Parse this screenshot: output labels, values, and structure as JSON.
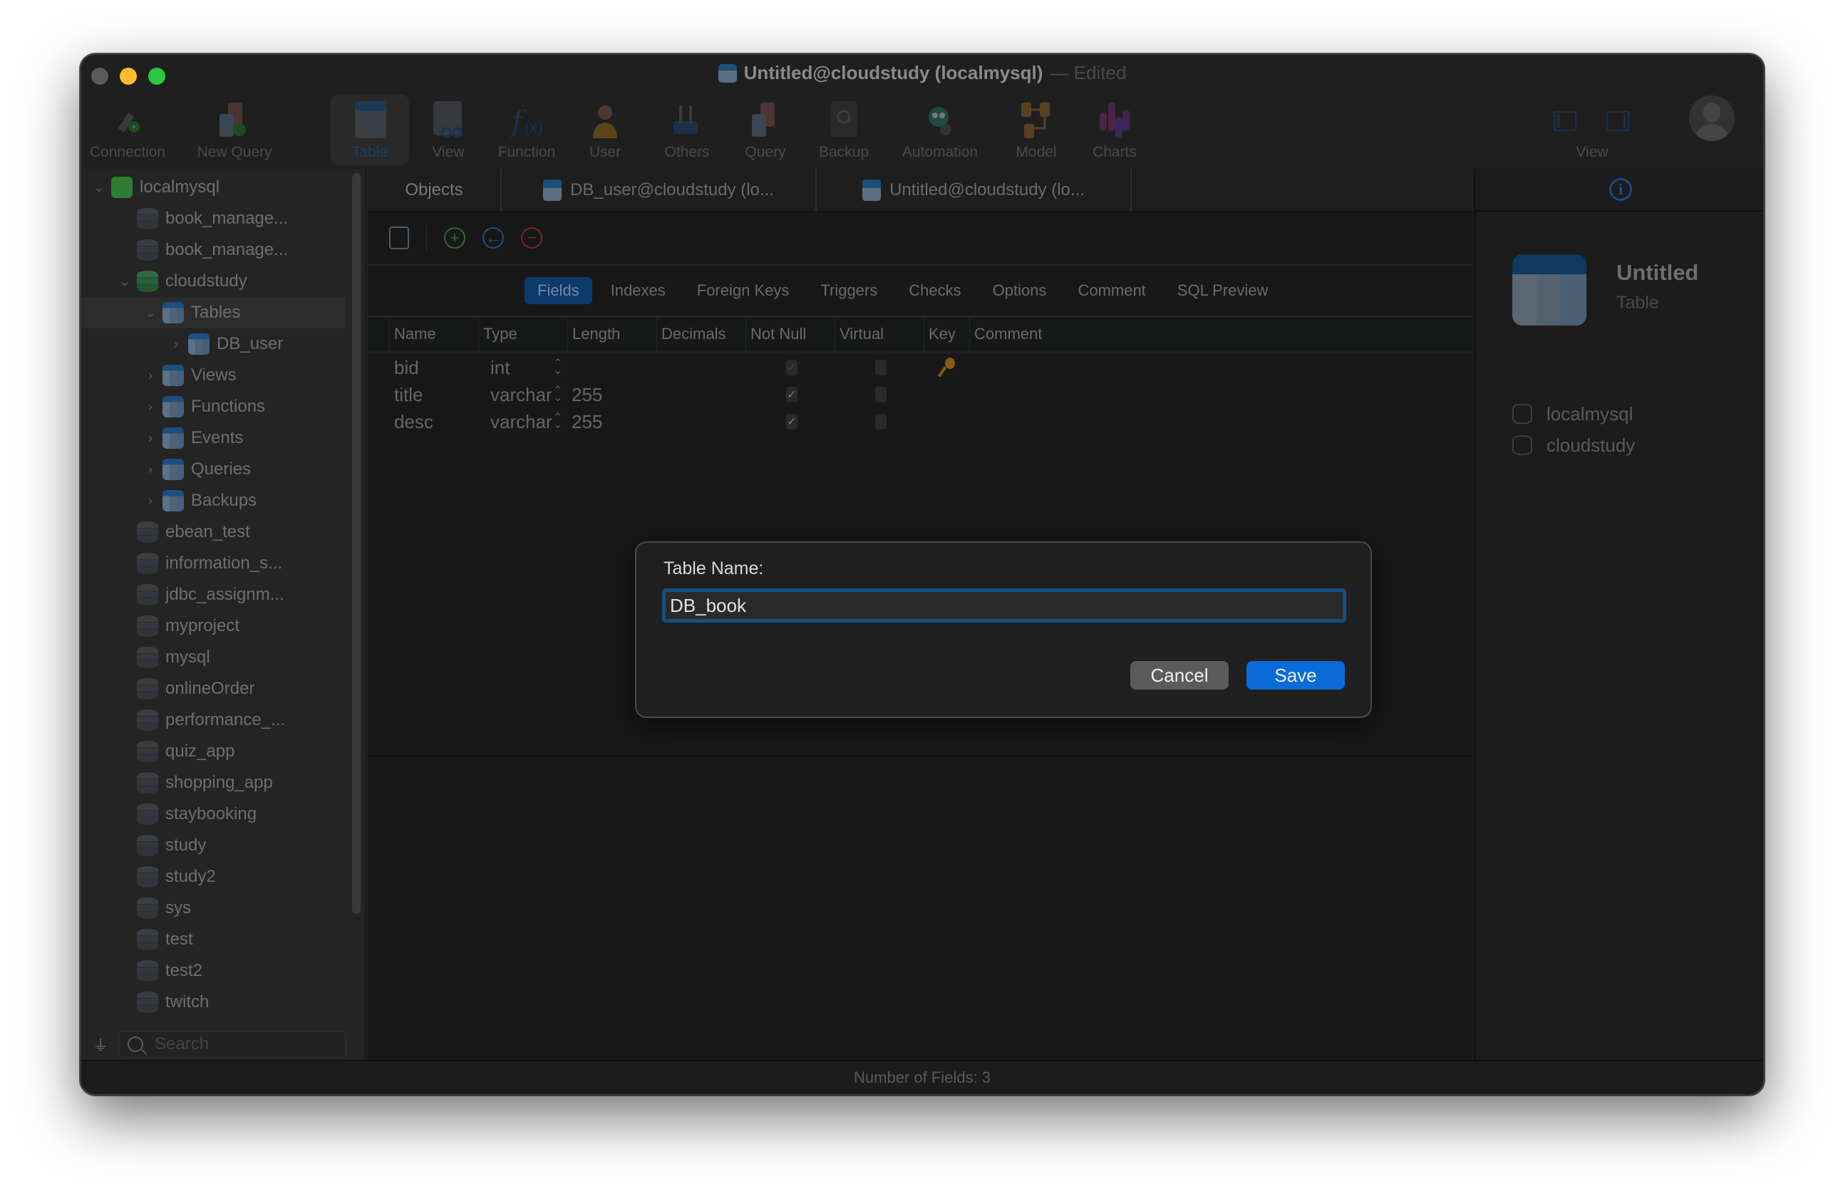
{
  "window": {
    "title": "Untitled@cloudstudy (localmysql)",
    "title_suffix": "— Edited",
    "traffic_colors": {
      "close": "#5a5a5a",
      "minimize": "#febc2e",
      "maximize": "#28c840"
    }
  },
  "toolbar": {
    "items": [
      {
        "label": "Connection",
        "icon": "plug-add-icon"
      },
      {
        "label": "New Query",
        "icon": "new-query-icon"
      },
      {
        "label": "Table",
        "icon": "table-icon",
        "active": true
      },
      {
        "label": "View",
        "icon": "view-icon"
      },
      {
        "label": "Function",
        "icon": "function-icon"
      },
      {
        "label": "User",
        "icon": "user-icon"
      },
      {
        "label": "Others",
        "icon": "tools-icon"
      },
      {
        "label": "Query",
        "icon": "query-icon"
      },
      {
        "label": "Backup",
        "icon": "backup-icon"
      },
      {
        "label": "Automation",
        "icon": "robot-icon"
      },
      {
        "label": "Model",
        "icon": "model-icon"
      },
      {
        "label": "Charts",
        "icon": "charts-icon"
      }
    ],
    "view_label": "View"
  },
  "sidebar": {
    "tree": [
      {
        "label": "localmysql",
        "level": 0,
        "chevron": "down",
        "icon": "mysql-connection-icon"
      },
      {
        "label": "book_manage...",
        "level": 1,
        "chevron": "",
        "icon": "database-icon"
      },
      {
        "label": "book_manage...",
        "level": 1,
        "chevron": "",
        "icon": "database-icon"
      },
      {
        "label": "cloudstudy",
        "level": 1,
        "chevron": "down",
        "icon": "database-open-icon"
      },
      {
        "label": "Tables",
        "level": 2,
        "chevron": "down",
        "icon": "tables-icon",
        "selected": true
      },
      {
        "label": "DB_user",
        "level": 3,
        "chevron": "right",
        "icon": "table-icon"
      },
      {
        "label": "Views",
        "level": 2,
        "chevron": "right",
        "icon": "views-icon"
      },
      {
        "label": "Functions",
        "level": 2,
        "chevron": "right",
        "icon": "functions-icon"
      },
      {
        "label": "Events",
        "level": 2,
        "chevron": "right",
        "icon": "events-clock-icon"
      },
      {
        "label": "Queries",
        "level": 2,
        "chevron": "right",
        "icon": "queries-icon"
      },
      {
        "label": "Backups",
        "level": 2,
        "chevron": "right",
        "icon": "backups-icon"
      },
      {
        "label": "ebean_test",
        "level": 1,
        "chevron": "",
        "icon": "database-icon"
      },
      {
        "label": "information_s...",
        "level": 1,
        "chevron": "",
        "icon": "database-icon"
      },
      {
        "label": "jdbc_assignm...",
        "level": 1,
        "chevron": "",
        "icon": "database-icon"
      },
      {
        "label": "myproject",
        "level": 1,
        "chevron": "",
        "icon": "database-icon"
      },
      {
        "label": "mysql",
        "level": 1,
        "chevron": "",
        "icon": "database-icon"
      },
      {
        "label": "onlineOrder",
        "level": 1,
        "chevron": "",
        "icon": "database-icon"
      },
      {
        "label": "performance_...",
        "level": 1,
        "chevron": "",
        "icon": "database-icon"
      },
      {
        "label": "quiz_app",
        "level": 1,
        "chevron": "",
        "icon": "database-icon"
      },
      {
        "label": "shopping_app",
        "level": 1,
        "chevron": "",
        "icon": "database-icon"
      },
      {
        "label": "staybooking",
        "level": 1,
        "chevron": "",
        "icon": "database-icon"
      },
      {
        "label": "study",
        "level": 1,
        "chevron": "",
        "icon": "database-icon"
      },
      {
        "label": "study2",
        "level": 1,
        "chevron": "",
        "icon": "database-icon"
      },
      {
        "label": "sys",
        "level": 1,
        "chevron": "",
        "icon": "database-icon"
      },
      {
        "label": "test",
        "level": 1,
        "chevron": "",
        "icon": "database-icon"
      },
      {
        "label": "test2",
        "level": 1,
        "chevron": "",
        "icon": "database-icon"
      },
      {
        "label": "twitch",
        "level": 1,
        "chevron": "",
        "icon": "database-icon"
      }
    ],
    "search_placeholder": "Search"
  },
  "tabs": [
    {
      "label": "Objects"
    },
    {
      "label": "DB_user@cloudstudy (lo...",
      "icon": "table-edit-icon"
    },
    {
      "label": "Untitled@cloudstudy (lo...",
      "icon": "table-edit-icon",
      "active": true
    }
  ],
  "editor": {
    "subtabs": [
      "Fields",
      "Indexes",
      "Foreign Keys",
      "Triggers",
      "Checks",
      "Options",
      "Comment",
      "SQL Preview"
    ],
    "active_subtab": "Fields",
    "columns": [
      "Name",
      "Type",
      "Length",
      "Decimals",
      "Not Null",
      "Virtual",
      "Key",
      "Comment"
    ],
    "rows": [
      {
        "name": "bid",
        "type": "int",
        "length": "",
        "decimals": "",
        "not_null": true,
        "not_null_disabled": true,
        "virtual": false,
        "key": "1",
        "comment": ""
      },
      {
        "name": "title",
        "type": "varchar",
        "length": "255",
        "decimals": "",
        "not_null": true,
        "not_null_disabled": false,
        "virtual": false,
        "key": "",
        "comment": ""
      },
      {
        "name": "desc",
        "type": "varchar",
        "length": "255",
        "decimals": "",
        "not_null": true,
        "not_null_disabled": false,
        "virtual": false,
        "key": "",
        "comment": ""
      }
    ]
  },
  "inspector": {
    "title": "Untitled",
    "subtitle": "Table",
    "items": [
      {
        "label": "localmysql",
        "icon": "mysql-dolphin-icon"
      },
      {
        "label": "cloudstudy",
        "icon": "database-icon"
      }
    ]
  },
  "status": {
    "text": "Number of Fields: 3"
  },
  "dialog": {
    "label": "Table Name:",
    "value": "DB_book",
    "cancel_label": "Cancel",
    "save_label": "Save",
    "accent": "#0a6bd8"
  }
}
